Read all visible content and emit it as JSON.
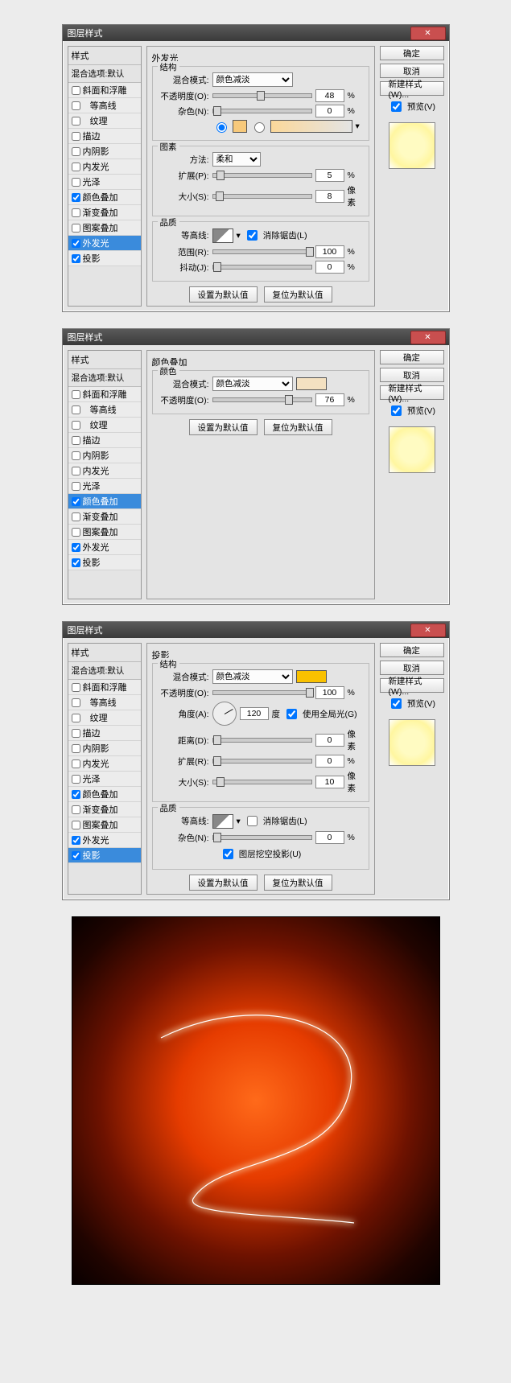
{
  "window_title": "图层样式",
  "buttons": {
    "ok": "确定",
    "cancel": "取消",
    "new_style": "新建样式(W)...",
    "preview": "预览(V)",
    "set_default": "设置为默认值",
    "reset_default": "复位为默认值"
  },
  "styles_panel": {
    "title": "样式",
    "blend_row": "混合选项:默认",
    "items": [
      {
        "label": "斜面和浮雕",
        "checked": false
      },
      {
        "label": "等高线",
        "checked": false
      },
      {
        "label": "纹理",
        "checked": false
      },
      {
        "label": "描边",
        "checked": false
      },
      {
        "label": "内阴影",
        "checked": false
      },
      {
        "label": "内发光",
        "checked": false
      },
      {
        "label": "光泽",
        "checked": false
      },
      {
        "label": "颜色叠加",
        "checked": true
      },
      {
        "label": "渐变叠加",
        "checked": false
      },
      {
        "label": "图案叠加",
        "checked": false
      },
      {
        "label": "外发光",
        "checked": true
      },
      {
        "label": "投影",
        "checked": true
      }
    ]
  },
  "dialogs": {
    "outer_glow": {
      "title": "外发光",
      "selected_index": 10,
      "struct_legend": "结构",
      "blend_mode_label": "混合模式:",
      "blend_mode_value": "颜色减淡",
      "opacity_label": "不透明度(O):",
      "opacity_value": "48",
      "opacity_unit": "%",
      "noise_label": "杂色(N):",
      "noise_value": "0",
      "noise_unit": "%",
      "color_swatch": "#f7c97b",
      "elements_legend": "图素",
      "technique_label": "方法:",
      "technique_value": "柔和",
      "spread_label": "扩展(P):",
      "spread_value": "5",
      "spread_unit": "%",
      "size_label": "大小(S):",
      "size_value": "8",
      "size_unit": "像素",
      "quality_legend": "品质",
      "contour_label": "等高线:",
      "antialias_label": "消除锯齿(L)",
      "antialias_checked": true,
      "range_label": "范围(R):",
      "range_value": "100",
      "range_unit": "%",
      "jitter_label": "抖动(J):",
      "jitter_value": "0",
      "jitter_unit": "%"
    },
    "color_overlay": {
      "title": "颜色叠加",
      "selected_index": 7,
      "group_legend": "颜色",
      "blend_mode_label": "混合模式:",
      "blend_mode_value": "颜色减淡",
      "opacity_label": "不透明度(O):",
      "opacity_value": "76",
      "opacity_unit": "%",
      "swatch": "#f4e1c1"
    },
    "drop_shadow": {
      "title": "投影",
      "selected_index": 11,
      "struct_legend": "结构",
      "blend_mode_label": "混合模式:",
      "blend_mode_value": "颜色减淡",
      "swatch": "#f9c100",
      "opacity_label": "不透明度(O):",
      "opacity_value": "100",
      "opacity_unit": "%",
      "angle_label": "角度(A):",
      "angle_value": "120",
      "angle_unit": "度",
      "global_light_label": "使用全局光(G)",
      "global_light_checked": true,
      "distance_label": "距离(D):",
      "distance_value": "0",
      "distance_unit": "像素",
      "spread_label": "扩展(R):",
      "spread_value": "0",
      "spread_unit": "%",
      "size_label": "大小(S):",
      "size_value": "10",
      "size_unit": "像素",
      "quality_legend": "品质",
      "contour_label": "等高线:",
      "antialias_label": "消除锯齿(L)",
      "antialias_checked": false,
      "noise_label": "杂色(N):",
      "noise_value": "0",
      "noise_unit": "%",
      "knockout_label": "图层挖空投影(U)",
      "knockout_checked": true
    }
  }
}
